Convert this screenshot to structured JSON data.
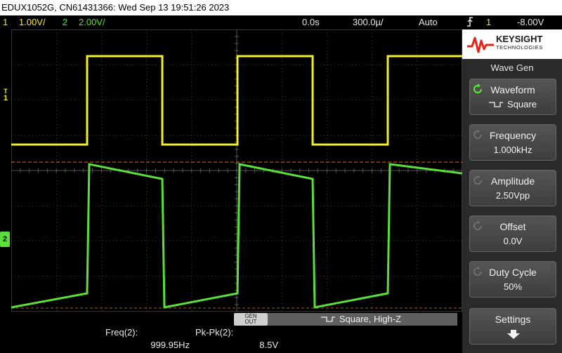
{
  "window": {
    "title": "EDUX1052G, CN61431366: Wed Sep 13 19:51:26 2023"
  },
  "status": {
    "ch1_num": "1",
    "ch1_scale": "1.00V/",
    "ch2_num": "2",
    "ch2_scale": "2.00V/",
    "time_delay": "0.0s",
    "time_scale": "300.0µ/",
    "trigger_mode": "Auto",
    "trigger_icon": "trigger-edge-icon",
    "trigger_source": "1",
    "trigger_level": "-8.00V"
  },
  "markers": {
    "trigger_level_label": "T",
    "ch1_label": "1",
    "ch2_label": "2"
  },
  "generator": {
    "out_label_line1": "GEN",
    "out_label_line2": "OUT",
    "status_text": "Square, High-Z"
  },
  "measurements": [
    {
      "label": "Freq(2):",
      "value": "999.95Hz"
    },
    {
      "label": "Pk-Pk(2):",
      "value": "8.5V"
    }
  ],
  "brand": {
    "name": "KEYSIGHT",
    "sub": "TECHNOLOGIES"
  },
  "menu": {
    "title": "Wave Gen",
    "softkeys": [
      {
        "label": "Waveform",
        "value": "Square",
        "active": true
      },
      {
        "label": "Frequency",
        "value": "1.000kHz",
        "active": false
      },
      {
        "label": "Amplitude",
        "value": "2.50Vpp",
        "active": false
      },
      {
        "label": "Offset",
        "value": "0.0V",
        "active": false
      },
      {
        "label": "Duty Cycle",
        "value": "50%",
        "active": false
      },
      {
        "label": "Settings",
        "value": "",
        "active": false
      }
    ]
  },
  "colors": {
    "ch1": "#f2ee2a",
    "ch2": "#5be03a",
    "grid": "#6a6a6a",
    "trigger_line": "#e07a30"
  }
}
